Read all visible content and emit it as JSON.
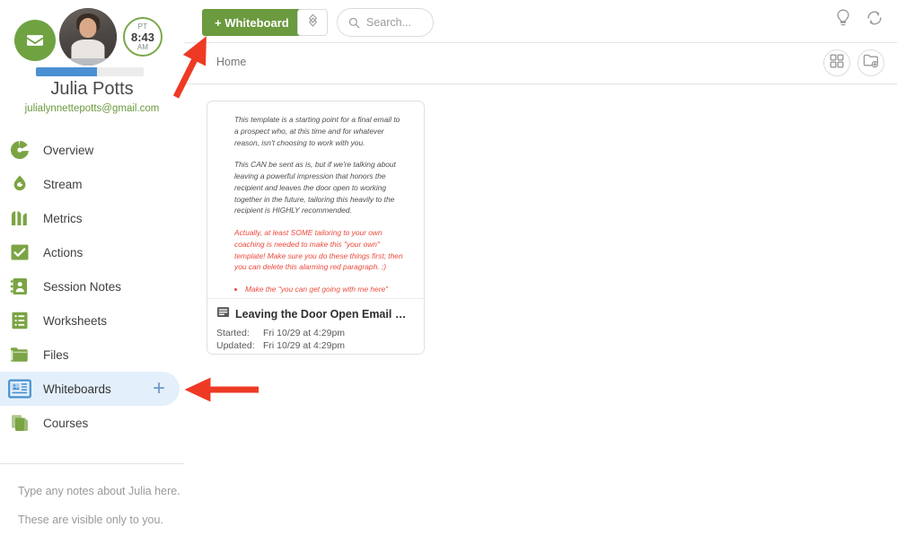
{
  "colors": {
    "brand_green": "#6b9a3f",
    "accent_blue": "#4a90d2",
    "selected_blue_bg": "#e3f0fb",
    "annotation_red": "#ee3a24",
    "email_link_green": "#6c9a3f",
    "warning_red_text": "#ea4a3b"
  },
  "sidebar": {
    "profile": {
      "name": "Julia Potts",
      "email": "julialynnettepotts@gmail.com",
      "clock": {
        "timezone": "PT",
        "time": "8:43",
        "meridiem": "AM"
      },
      "progress_percent": 57,
      "env_icon": "envelope-icon",
      "avatar_icon": "avatar"
    },
    "items": [
      {
        "label": "Overview",
        "icon": "overview-icon",
        "selected": false
      },
      {
        "label": "Stream",
        "icon": "stream-icon",
        "selected": false
      },
      {
        "label": "Metrics",
        "icon": "metrics-icon",
        "selected": false
      },
      {
        "label": "Actions",
        "icon": "actions-check-icon",
        "selected": false
      },
      {
        "label": "Session Notes",
        "icon": "session-notes-icon",
        "selected": false
      },
      {
        "label": "Worksheets",
        "icon": "worksheets-icon",
        "selected": false
      },
      {
        "label": "Files",
        "icon": "files-folder-icon",
        "selected": false
      },
      {
        "label": "Whiteboards",
        "icon": "whiteboards-icon",
        "selected": true,
        "action_icon": "plus-icon",
        "action_label": "+"
      },
      {
        "label": "Courses",
        "icon": "courses-icon",
        "selected": false
      }
    ],
    "notes": {
      "line1": "Type any notes about Julia here.",
      "line2": "These are visible only to you."
    }
  },
  "topbar": {
    "new_whiteboard_label": "+ Whiteboard",
    "sort_icon": "sort-chevrons-icon",
    "search": {
      "placeholder": "Search...",
      "value": "",
      "icon": "search-icon"
    },
    "right_icons": [
      {
        "name": "lightbulb-icon",
        "label": "Tips"
      },
      {
        "name": "refresh-icon",
        "label": "Refresh"
      }
    ]
  },
  "tabrow": {
    "breadcrumb": "Home",
    "view_icons": [
      {
        "name": "grid-view-icon",
        "label": "Grid view"
      },
      {
        "name": "new-folder-icon",
        "label": "New folder"
      }
    ]
  },
  "main": {
    "cards": [
      {
        "title": "Leaving the Door Open Email Tem…",
        "doc_icon": "document-icon",
        "meta": [
          {
            "key": "Started:",
            "value": "Fri 10/29 at 4:29pm"
          },
          {
            "key": "Updated:",
            "value": "Fri 10/29 at 4:29pm"
          }
        ],
        "preview": {
          "paragraphs": [
            {
              "text": "This template is a starting point for a final email to a prospect who, at this time and for whatever reason, isn't choosing to work with you.",
              "color": "normal"
            },
            {
              "text": "This CAN be sent as is, but if we're talking about leaving a powerful impression that honors the recipient and leaves the door open to working together in the future, tailoring this heavily to the recipient is HIGHLY recommended.",
              "color": "normal"
            },
            {
              "text": "Actually, at least SOME tailoring to your own coaching is needed to make this \"your own\" template!  Make sure you do these things first; then you can delete this alarming red paragraph. :)",
              "color": "red"
            }
          ],
          "bullets": [
            "Make the \"you can get going with me here\" actually link to one of your Offerings or"
          ]
        }
      }
    ]
  },
  "annotations": [
    {
      "name": "arrow-to-new-whiteboard-button",
      "direction": "up-right"
    },
    {
      "name": "arrow-to-whiteboards-nav-item",
      "direction": "left"
    }
  ]
}
